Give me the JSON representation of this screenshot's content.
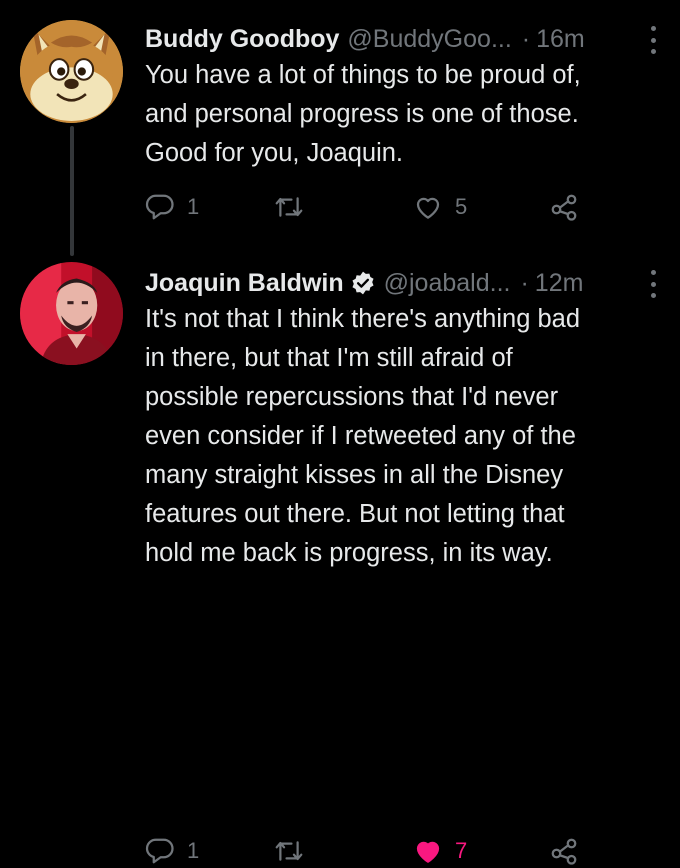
{
  "tweets": [
    {
      "display_name": "Buddy Goodboy",
      "handle": "@BuddyGoo...",
      "separator": "·",
      "time": "16m",
      "verified": false,
      "avatar_icon": "cartoon-fox-avatar",
      "body_lines": [
        "You have a lot of things to be proud of,",
        "and personal progress is one of those.",
        "Good for you, Joaquin."
      ],
      "reply_count": "1",
      "retweet_count": "",
      "like_count": "5",
      "liked": false
    },
    {
      "display_name": "Joaquin Baldwin",
      "handle": "@joabald...",
      "separator": "·",
      "time": "12m",
      "verified": true,
      "avatar_icon": "profile-photo-avatar",
      "body_lines": [
        "It's not that I think there's anything bad",
        "in there, but that I'm still afraid of",
        "possible repercussions that I'd never",
        "even consider if I retweeted any of the",
        "many straight kisses in all the Disney",
        "features out there. But not letting that",
        "hold me back is progress, in its way."
      ],
      "reply_count": "1",
      "retweet_count": "",
      "like_count": "7",
      "liked": true
    }
  ],
  "colors": {
    "background": "#000000",
    "text": "#e7e9ea",
    "secondary": "#71767b",
    "like_active": "#f91880",
    "thread_line": "#333639"
  },
  "icons": [
    "reply-icon",
    "retweet-icon",
    "like-icon",
    "share-icon",
    "more-options-icon",
    "verified-badge-icon"
  ]
}
